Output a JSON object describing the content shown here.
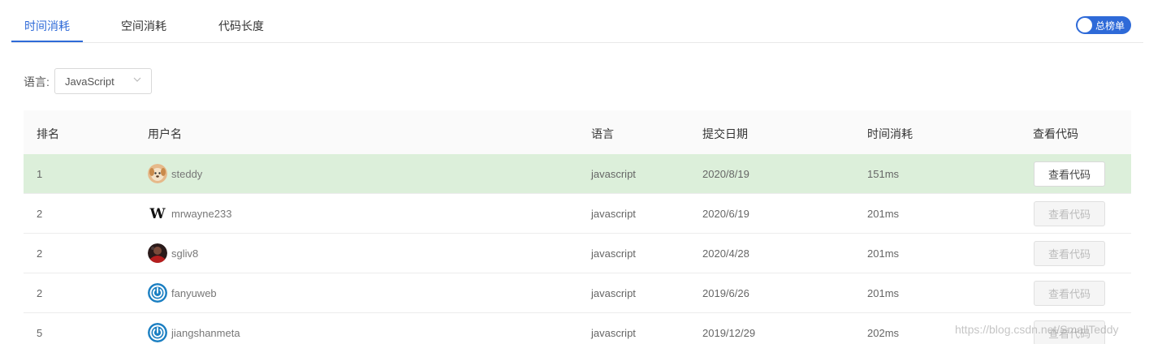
{
  "tabs": [
    {
      "label": "时间消耗",
      "active": true
    },
    {
      "label": "空间消耗",
      "active": false
    },
    {
      "label": "代码长度",
      "active": false
    }
  ],
  "toggle": {
    "label": "总榜单",
    "on": true
  },
  "filter": {
    "label": "语言:",
    "value": "JavaScript",
    "icon": "chevron-down-icon"
  },
  "table": {
    "headers": [
      "排名",
      "用户名",
      "语言",
      "提交日期",
      "时间消耗",
      "查看代码"
    ],
    "rows": [
      {
        "rank": "1",
        "user": "steddy",
        "avatar": "dog-avatar",
        "lang": "javascript",
        "date": "2020/8/19",
        "time": "151ms",
        "action": "查看代码",
        "enabled": true,
        "highlight": true
      },
      {
        "rank": "2",
        "user": "mrwayne233",
        "avatar": "w-letter-avatar",
        "lang": "javascript",
        "date": "2020/6/19",
        "time": "201ms",
        "action": "查看代码",
        "enabled": false,
        "highlight": false
      },
      {
        "rank": "2",
        "user": "sgliv8",
        "avatar": "photo-avatar",
        "lang": "javascript",
        "date": "2020/4/28",
        "time": "201ms",
        "action": "查看代码",
        "enabled": false,
        "highlight": false
      },
      {
        "rank": "2",
        "user": "fanyuweb",
        "avatar": "power-icon-avatar",
        "lang": "javascript",
        "date": "2019/6/26",
        "time": "201ms",
        "action": "查看代码",
        "enabled": false,
        "highlight": false
      },
      {
        "rank": "5",
        "user": "jiangshanmeta",
        "avatar": "power-icon-avatar",
        "lang": "javascript",
        "date": "2019/12/29",
        "time": "202ms",
        "action": "查看代码",
        "enabled": false,
        "highlight": false
      }
    ]
  },
  "watermark": "https://blog.csdn.net/SmallTeddy",
  "colors": {
    "accent": "#2e6ad8",
    "highlight_row": "#dcefda"
  }
}
